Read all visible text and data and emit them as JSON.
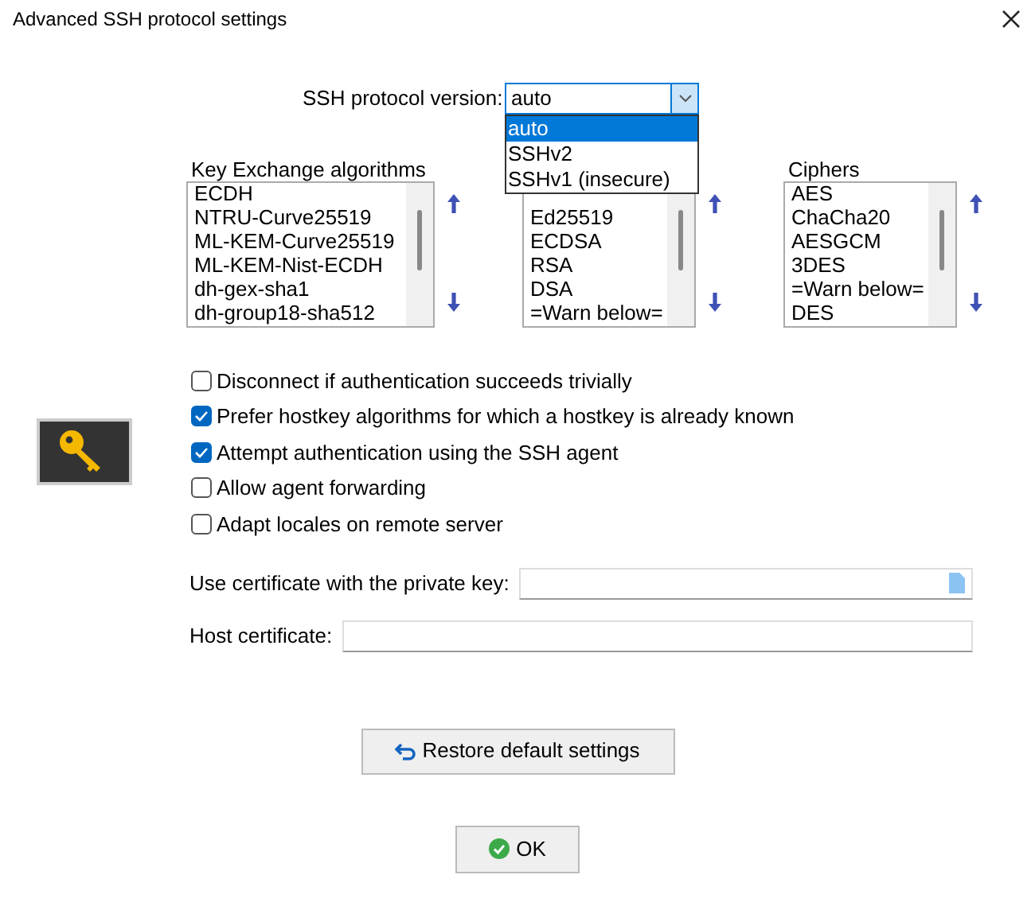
{
  "window": {
    "title": "Advanced SSH protocol settings"
  },
  "protocol": {
    "label": "SSH protocol version:",
    "value": "auto",
    "expanded": true,
    "options": [
      {
        "label": "auto",
        "selected": true
      },
      {
        "label": "SSHv2",
        "selected": false
      },
      {
        "label": "SSHv1 (insecure)",
        "selected": false
      }
    ]
  },
  "lists": [
    {
      "label": "Key Exchange algorithms",
      "items": [
        "ECDH",
        "NTRU-Curve25519",
        "ML-KEM-Curve25519",
        "ML-KEM-Nist-ECDH",
        "dh-gex-sha1",
        "dh-group18-sha512"
      ]
    },
    {
      "items": [
        "Ed25519",
        "ECDSA",
        "RSA",
        "DSA",
        "=Warn below="
      ]
    },
    {
      "label": "Ciphers",
      "items": [
        "AES",
        "ChaCha20",
        "AESGCM",
        "3DES",
        "=Warn below=",
        "DES"
      ]
    }
  ],
  "options": [
    {
      "label": "Disconnect if authentication succeeds trivially",
      "checked": false
    },
    {
      "label": "Prefer hostkey algorithms for which a hostkey is already known",
      "checked": true
    },
    {
      "label": "Attempt authentication using the SSH agent",
      "checked": true
    },
    {
      "label": "Allow agent forwarding",
      "checked": false
    },
    {
      "label": "Adapt locales on remote server",
      "checked": false
    }
  ],
  "fields": [
    {
      "label": "Use certificate with the private key:",
      "kind": "file"
    },
    {
      "label": "Host certificate:",
      "kind": "text"
    }
  ],
  "buttons": [
    {
      "label": "Restore default settings",
      "kind": "restore"
    },
    {
      "label": "OK",
      "kind": "ok"
    }
  ]
}
